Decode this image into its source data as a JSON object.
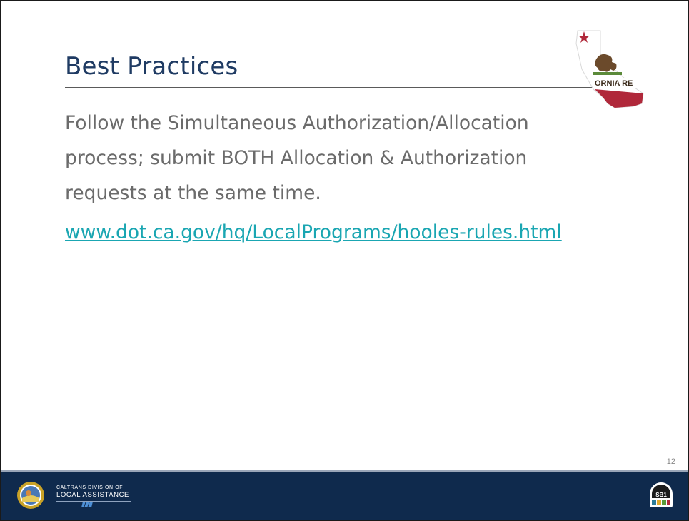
{
  "slide": {
    "title": "Best Practices",
    "body": "Follow the Simultaneous Authorization/Allocation process; submit BOTH Allocation & Authorization requests at the same time.",
    "link_text": "www.dot.ca.gov/hq/LocalPrograms/hooles-rules.html",
    "page_number": "12"
  },
  "header_graphic": {
    "icon": "california-flag-icon",
    "text": "ORNIA RE"
  },
  "footer": {
    "division_line1": "CALTRANS DIVISION OF",
    "division_line2": "LOCAL ASSISTANCE",
    "seal_icon": "california-seal-icon",
    "caltrans_icon": "caltrans-logo-icon",
    "sb1_icon": "sb1-logo-icon",
    "sb1_text": "SB1"
  },
  "colors": {
    "title": "#1f3b63",
    "body_text": "#6b6b6b",
    "link": "#1aa6b2",
    "footer_bg": "#0f2a4d",
    "flag_red": "#b0283a"
  }
}
